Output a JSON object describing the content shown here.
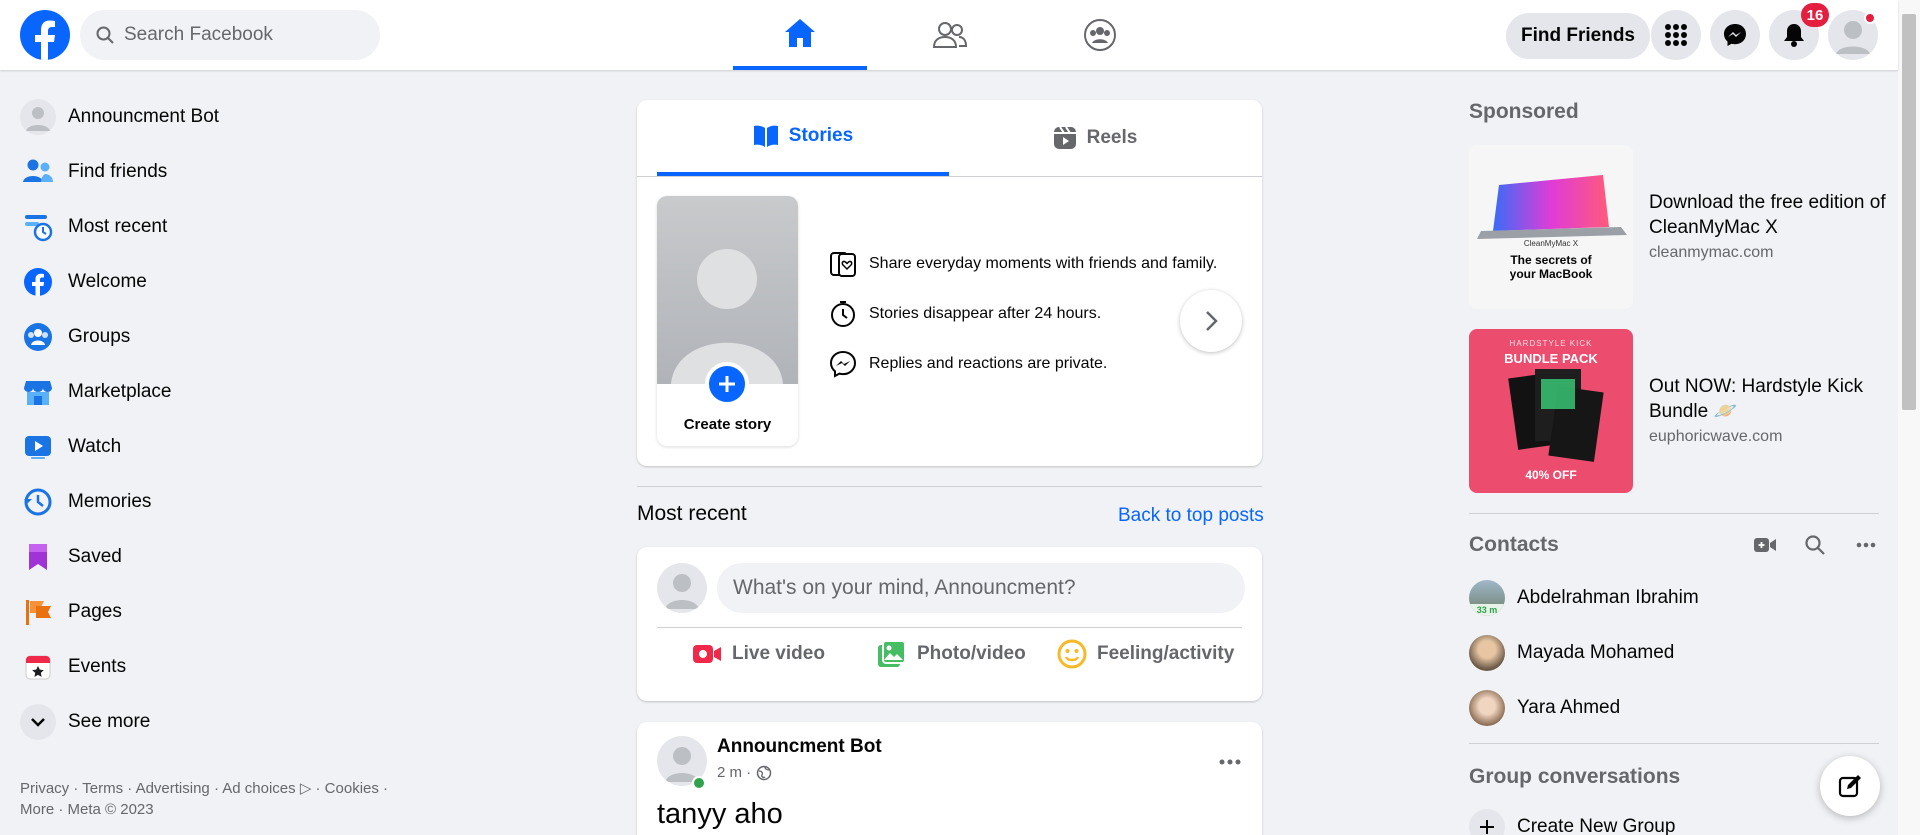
{
  "colors": {
    "brand": "#0866ff",
    "badge": "#e41e3f",
    "secondary_text": "#65676b"
  },
  "header": {
    "search_placeholder": "Search Facebook",
    "find_friends": "Find Friends",
    "notifications_count": "16",
    "nav_tabs": [
      "home",
      "friends",
      "groups"
    ],
    "active_tab": "home"
  },
  "sidebar": {
    "items": [
      {
        "label": "Announcment Bot",
        "icon": "avatar-icon"
      },
      {
        "label": "Find friends",
        "icon": "friends-icon"
      },
      {
        "label": "Most recent",
        "icon": "feeds-icon"
      },
      {
        "label": "Welcome",
        "icon": "facebook-icon"
      },
      {
        "label": "Groups",
        "icon": "groups-icon"
      },
      {
        "label": "Marketplace",
        "icon": "marketplace-icon"
      },
      {
        "label": "Watch",
        "icon": "watch-icon"
      },
      {
        "label": "Memories",
        "icon": "memories-icon"
      },
      {
        "label": "Saved",
        "icon": "saved-icon"
      },
      {
        "label": "Pages",
        "icon": "pages-icon"
      },
      {
        "label": "Events",
        "icon": "events-icon"
      },
      {
        "label": "See more",
        "icon": "chevron-down-icon"
      }
    ],
    "footer_line1": "Privacy · Terms · Advertising · Ad choices ▷ · Cookies ·",
    "footer_line2": "More · Meta © 2023"
  },
  "stories": {
    "tabs": [
      "Stories",
      "Reels"
    ],
    "active_tab": "Stories",
    "create_label": "Create story",
    "info": [
      "Share everyday moments with friends and family.",
      "Stories disappear after 24 hours.",
      "Replies and reactions are private."
    ]
  },
  "feed": {
    "section_title": "Most recent",
    "back_link": "Back to top posts",
    "composer_placeholder": "What's on your mind, Announcment?",
    "actions": [
      "Live video",
      "Photo/video",
      "Feeling/activity"
    ],
    "post": {
      "author": "Announcment Bot",
      "time": "2 m ·",
      "text": "tanyy aho"
    }
  },
  "right": {
    "sponsored_title": "Sponsored",
    "ads": [
      {
        "title": "Download the free edition of CleanMyMac X",
        "domain": "cleanmymac.com",
        "img_text1": "The secrets of",
        "img_text2": "your MacBook",
        "img_brand": "CleanMyMac X"
      },
      {
        "title": "Out NOW: Hardstyle Kick Bundle 🪐",
        "domain": "euphoricwave.com",
        "img_top": "HARDSTYLE KICK",
        "img_title": "BUNDLE PACK",
        "img_bottom": "40% OFF"
      }
    ],
    "contacts_title": "Contacts",
    "contacts": [
      {
        "name": "Abdelrahman Ibrahim",
        "badge": "33 m"
      },
      {
        "name": "Mayada Mohamed"
      },
      {
        "name": "Yara Ahmed"
      }
    ],
    "groups_title": "Group conversations",
    "create_group": "Create New Group"
  }
}
